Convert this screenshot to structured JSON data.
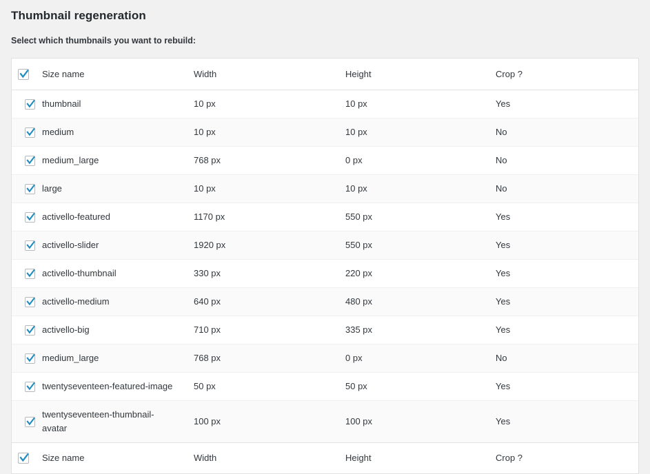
{
  "page": {
    "title": "Thumbnail regeneration",
    "subtitle": "Select which thumbnails you want to rebuild:"
  },
  "colors": {
    "page_background": "#f1f1f1",
    "panel_background": "#ffffff",
    "heading_text": "#23282d",
    "body_text": "#32373c",
    "border": "#e1e1e1",
    "row_alt_background": "#fafafa",
    "checkbox_border": "#b4b9be",
    "checkbox_check": "#1e8cbe"
  },
  "table": {
    "select_all_checked": true,
    "columns": [
      {
        "key": "name",
        "label": "Size name"
      },
      {
        "key": "width",
        "label": "Width"
      },
      {
        "key": "height",
        "label": "Height"
      },
      {
        "key": "crop",
        "label": "Crop ?"
      }
    ],
    "header": {
      "name": "Size name",
      "width": "Width",
      "height": "Height",
      "crop": "Crop ?"
    },
    "footer": {
      "name": "Size name",
      "width": "Width",
      "height": "Height",
      "crop": "Crop ?"
    },
    "rows": [
      {
        "name": "thumbnail",
        "width": "10 px",
        "height": "10 px",
        "crop": "Yes",
        "checked": true
      },
      {
        "name": "medium",
        "width": "10 px",
        "height": "10 px",
        "crop": "No",
        "checked": true
      },
      {
        "name": "medium_large",
        "width": "768 px",
        "height": "0 px",
        "crop": "No",
        "checked": true
      },
      {
        "name": "large",
        "width": "10 px",
        "height": "10 px",
        "crop": "No",
        "checked": true
      },
      {
        "name": "activello-featured",
        "width": "1170 px",
        "height": "550 px",
        "crop": "Yes",
        "checked": true
      },
      {
        "name": "activello-slider",
        "width": "1920 px",
        "height": "550 px",
        "crop": "Yes",
        "checked": true
      },
      {
        "name": "activello-thumbnail",
        "width": "330 px",
        "height": "220 px",
        "crop": "Yes",
        "checked": true
      },
      {
        "name": "activello-medium",
        "width": "640 px",
        "height": "480 px",
        "crop": "Yes",
        "checked": true
      },
      {
        "name": "activello-big",
        "width": "710 px",
        "height": "335 px",
        "crop": "Yes",
        "checked": true
      },
      {
        "name": "medium_large",
        "width": "768 px",
        "height": "0 px",
        "crop": "No",
        "checked": true
      },
      {
        "name": "twentyseventeen-featured-image",
        "width": "50 px",
        "height": "50 px",
        "crop": "Yes",
        "checked": true
      },
      {
        "name": "twentyseventeen-thumbnail-avatar",
        "width": "100 px",
        "height": "100 px",
        "crop": "Yes",
        "checked": true
      }
    ]
  },
  "icons": {
    "checkmark": "check-icon"
  }
}
